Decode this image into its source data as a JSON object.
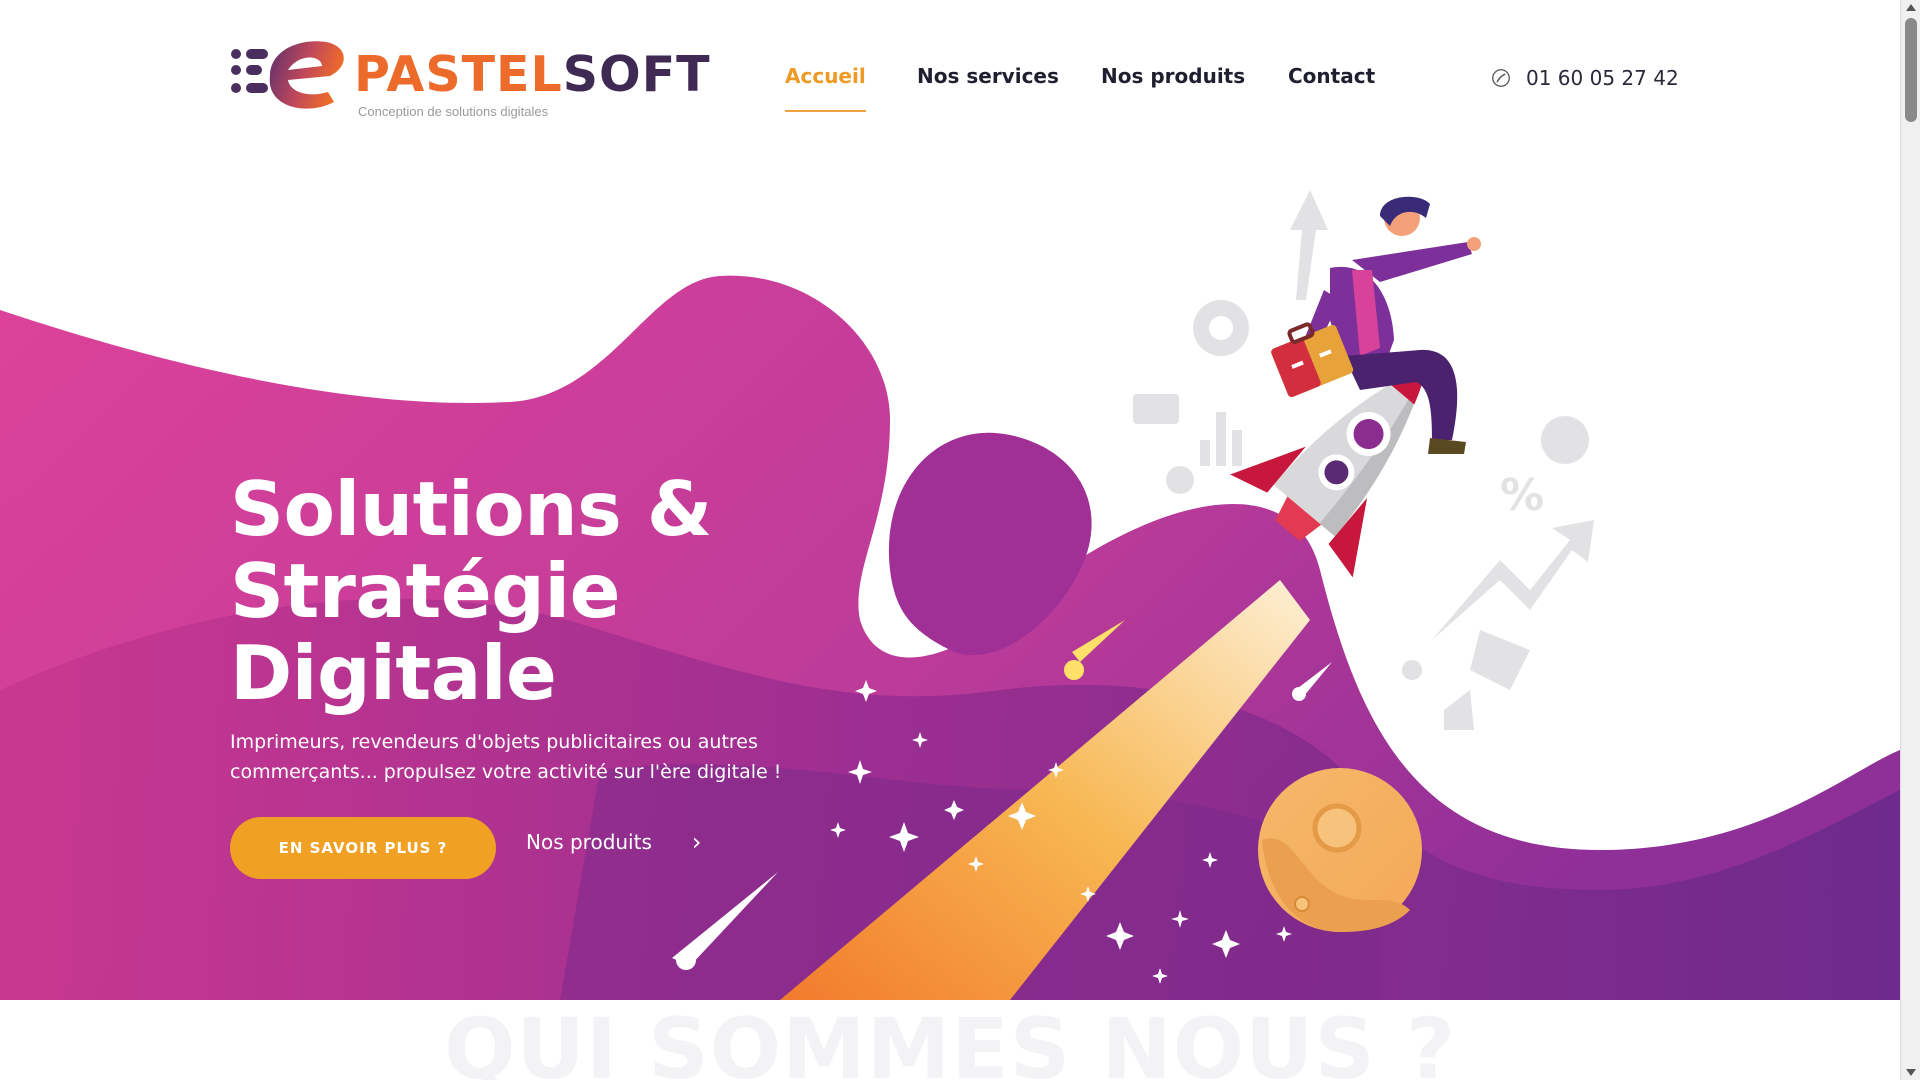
{
  "brand": {
    "name_part1": "PASTEL",
    "name_part2": "SOFT",
    "tagline": "Conception de solutions digitales",
    "accent_color": "#ec6b2b",
    "dark_color": "#3e2a52"
  },
  "nav": {
    "items": [
      {
        "label": "Accueil",
        "active": true
      },
      {
        "label": "Nos services",
        "active": false
      },
      {
        "label": "Nos produits",
        "active": false
      },
      {
        "label": "Contact",
        "active": false
      }
    ],
    "active_color": "#f09a26"
  },
  "phone": {
    "icon": "phone-icon",
    "number": "01 60 05 27 42"
  },
  "hero": {
    "title_lines": [
      "Solutions &",
      "Stratégie",
      "Digitale"
    ],
    "subtitle_lines": [
      "Imprimeurs, revendeurs d'objets publicitaires ou autres",
      "commerçants... propulsez votre activité sur l'ère digitale !"
    ],
    "cta_primary": "EN SAVOIR PLUS ?",
    "cta_secondary": "Nos produits",
    "cta_secondary_icon": "chevron-right-icon",
    "illustration": "businessman-riding-rocket-illustration",
    "colors": {
      "pink": "#d63f98",
      "purple": "#7a2b8e",
      "orange": "#f0a124"
    }
  },
  "about": {
    "title": "QUI SOMMES NOUS ?"
  }
}
